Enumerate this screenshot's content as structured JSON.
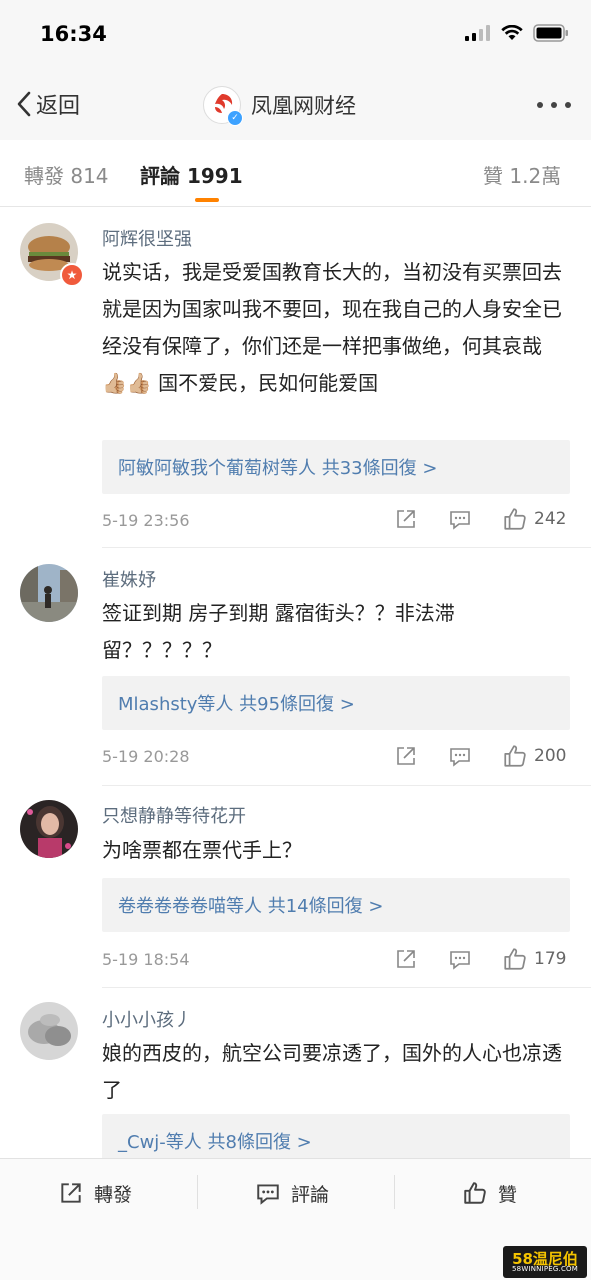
{
  "status_bar": {
    "time": "16:34"
  },
  "nav": {
    "back_label": "返回",
    "title": "凤凰网财经",
    "logo_text": "ifeng"
  },
  "tabs": [
    {
      "label": "轉發 814"
    },
    {
      "label": "評論 1991"
    },
    {
      "label": "贊 1.2萬"
    }
  ],
  "comments": [
    {
      "user": "阿辉很坚强",
      "text": "说实话，我是受爱国教育长大的，当初没有买票回去就是因为国家叫我不要回，现在我自己的人身安全已经没有保障了，你们还是一样把事做绝，何其哀哉 👍🏼👍🏼 国不爱民，民如何能爱国",
      "replies": "阿敏阿敏我个葡萄树等人 共33條回復 >",
      "time": "5-19 23:56",
      "likes": "242"
    },
    {
      "user": "崔姝妤",
      "text": "签证到期 房子到期 露宿街头？？非法滞留？？？？？",
      "replies": "Mlashsty等人 共95條回復 >",
      "time": "5-19 20:28",
      "likes": "200"
    },
    {
      "user": "只想静静等待花开",
      "text": "为啥票都在票代手上？",
      "replies": "卷卷卷卷卷喵等人 共14條回復 >",
      "time": "5-19 18:54",
      "likes": "179"
    },
    {
      "user": "小小小孩丿",
      "text": "娘的西皮的，航空公司要凉透了，国外的人心也凉透了",
      "replies": "_Cwj-等人 共8條回復 >",
      "time": "",
      "likes": ""
    }
  ],
  "bottom_bar": {
    "repost": "轉發",
    "comment": "評論",
    "like": "贊"
  },
  "watermark": {
    "top": "58温尼伯",
    "bottom": "58WINNIPEG.COM"
  },
  "colors": {
    "accent": "#ff8200",
    "link": "#507daf",
    "username": "#5d6d7e"
  }
}
